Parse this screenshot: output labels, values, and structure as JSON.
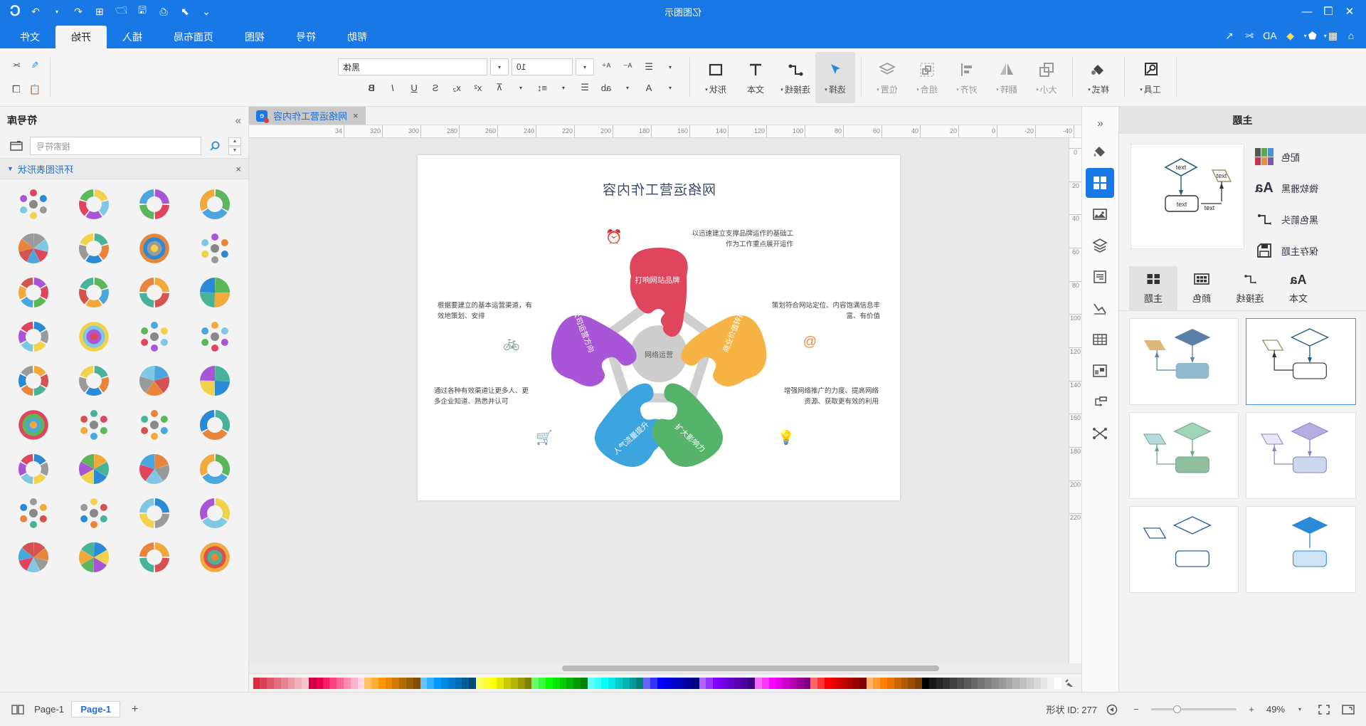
{
  "window": {
    "title": "亿图图示",
    "left_icons": [
      "close-icon",
      "restore-icon",
      "minimize-icon"
    ],
    "right_icons": [
      "chevron-down-icon",
      "export-icon",
      "print-icon",
      "save-icon",
      "open-icon",
      "new-icon",
      "undo-icon",
      "redo-icon"
    ],
    "logo": "C"
  },
  "quick_access": {
    "items": [
      "home-icon",
      "grid-icon",
      "shapes-icon",
      "ai-icon",
      "AD",
      "cut-icon",
      "pointer-icon"
    ]
  },
  "ribbon_tabs": [
    {
      "label": "文件",
      "active": false
    },
    {
      "label": "开始",
      "active": true
    },
    {
      "label": "插入",
      "active": false
    },
    {
      "label": "页面布局",
      "active": false
    },
    {
      "label": "视图",
      "active": false
    },
    {
      "label": "符号",
      "active": false
    },
    {
      "label": "帮助",
      "active": false
    }
  ],
  "ribbon": {
    "groups": [
      {
        "buttons": [
          {
            "label": "工具",
            "icon": "tool-icon",
            "dim": false,
            "caret": true,
            "selected": false
          },
          {
            "label": "样式",
            "icon": "fill-icon",
            "dim": false,
            "caret": true,
            "selected": false
          }
        ]
      },
      {
        "buttons": [
          {
            "label": "大小",
            "icon": "size-icon",
            "dim": true,
            "caret": true,
            "selected": false
          },
          {
            "label": "翻转",
            "icon": "flip-icon",
            "dim": true,
            "caret": true,
            "selected": false
          },
          {
            "label": "对齐",
            "icon": "align-icon",
            "dim": true,
            "caret": true,
            "selected": false
          },
          {
            "label": "组合",
            "icon": "group-icon",
            "dim": true,
            "caret": true,
            "selected": false
          },
          {
            "label": "位置",
            "icon": "layer-icon",
            "dim": true,
            "caret": true,
            "selected": false
          }
        ]
      },
      {
        "buttons": [
          {
            "label": "选择",
            "icon": "select-arrow-icon",
            "dim": false,
            "caret": true,
            "selected": true
          },
          {
            "label": "连接线",
            "icon": "connector-icon",
            "dim": false,
            "caret": true,
            "selected": false
          },
          {
            "label": "文本",
            "icon": "text-icon",
            "dim": false,
            "caret": false,
            "selected": false
          },
          {
            "label": "形状",
            "icon": "shape-icon",
            "dim": false,
            "caret": true,
            "selected": false
          }
        ]
      }
    ],
    "font": {
      "name_value": "黑体",
      "size_value": "10",
      "row1_icons": [
        "list-align-icon",
        "decrease-font-icon",
        "increase-font-icon"
      ],
      "row2_icons": [
        "font-color-icon",
        "highlight-icon",
        "bullets-icon",
        "line-spacing-icon",
        "clear-format-icon",
        "superscript-icon",
        "subscript-icon",
        "strikethrough-icon",
        "underline-icon",
        "italic-icon",
        "bold-icon"
      ],
      "clipboard_icons": [
        "copy-icon",
        "paste-icon",
        "format-painter-icon",
        "scissors-icon"
      ]
    }
  },
  "left_panel": {
    "title": "主题",
    "options": [
      {
        "label": "配色",
        "icon": "color-swatch-icon"
      },
      {
        "label": "微软雅黑",
        "icon": "font-Aa-icon"
      },
      {
        "label": "黑色箭头",
        "icon": "connector-icon"
      },
      {
        "label": "保存主题",
        "icon": "save-icon"
      }
    ],
    "tabs": [
      {
        "label": "文本",
        "icon": "font-Aa-icon",
        "active": false
      },
      {
        "label": "连接线",
        "icon": "connector-icon",
        "active": false
      },
      {
        "label": "颜色",
        "icon": "palette-grid-icon",
        "active": false
      },
      {
        "label": "主题",
        "icon": "theme-grid-icon",
        "active": true
      }
    ],
    "thumbnails": [
      {
        "id": "theme-1",
        "selected": false,
        "colors": [
          "#4a6fa5",
          "#ddb878",
          "#8fb8cc"
        ]
      },
      {
        "id": "theme-2",
        "selected": true,
        "colors": [
          "#ffffff",
          "#ffffff",
          "#ffffff"
        ]
      },
      {
        "id": "theme-3",
        "selected": false,
        "colors": [
          "#9fd4b4",
          "#b8d8e0",
          "#8fbf9e"
        ]
      },
      {
        "id": "theme-4",
        "selected": false,
        "colors": [
          "#b6aee0",
          "#ccd8ee",
          "#c9c0e8"
        ]
      },
      {
        "id": "theme-5",
        "selected": false,
        "colors": [
          "#2a8fd8",
          "#cfe3f2",
          "#2a8fd8"
        ]
      },
      {
        "id": "theme-6",
        "selected": false,
        "colors": [
          "#ffffff",
          "#ffffff",
          "#ffffff"
        ]
      }
    ]
  },
  "rail": {
    "top_icon": "collapse-left-icon",
    "buttons": [
      {
        "icon": "fill-bucket-icon",
        "active": false
      },
      {
        "icon": "shapes-grid-icon",
        "active": true
      },
      {
        "icon": "image-icon",
        "active": false
      },
      {
        "icon": "layers-icon",
        "active": false
      },
      {
        "icon": "notes-icon",
        "active": false
      },
      {
        "icon": "chart-icon",
        "active": false
      },
      {
        "icon": "table-icon",
        "active": false
      },
      {
        "icon": "container-icon",
        "active": false
      },
      {
        "icon": "flow-icon",
        "active": false
      },
      {
        "icon": "shuffle-icon",
        "active": false
      }
    ]
  },
  "document_tab": {
    "label": "网络运营工作内容",
    "close": "×"
  },
  "rulers": {
    "h_ticks": [
      "-40",
      "-20",
      "0",
      "20",
      "40",
      "60",
      "80",
      "100",
      "120",
      "140",
      "160",
      "180",
      "200",
      "220",
      "240",
      "260",
      "280",
      "300",
      "320",
      "34"
    ],
    "v_ticks": [
      "0",
      "20",
      "40",
      "60",
      "80",
      "100",
      "120",
      "140",
      "160",
      "180",
      "200",
      "220"
    ]
  },
  "right_panel": {
    "title": "符号库",
    "collapse_icon": "chevron-right-icon",
    "search_placeholder": "搜索符号",
    "library_icon": "library-icon",
    "search_icon": "search-icon",
    "category": "环形图表形状",
    "category_close": "×",
    "cells": [
      "donut-3-segment",
      "donut-5-segment",
      "donut-4-segment",
      "donut-gray-ring",
      "node-cluster-1",
      "hex-cluster",
      "donut-arrow-ring",
      "ring-outline",
      "dot-network-1",
      "dot-network-2",
      "block-network",
      "node-tree",
      "small-nodes-1",
      "small-nodes-2",
      "circle-nodes",
      "grid-network",
      "radial-blue",
      "target-rings",
      "pie-3-color",
      "flower-blue",
      "pie-4-color",
      "pie-multi",
      "pie-gray-orange",
      "pie-teal",
      "pie-rainbow",
      "pie-6-color",
      "pie-split",
      "donut-multi",
      "radial-chart-1",
      "radial-chart-2",
      "radial-chart-3",
      "radial-chart-4",
      "radial-chart-5",
      "radial-chart-6",
      "radial-chart-7",
      "radial-chart-8"
    ]
  },
  "status_bar": {
    "fit_icon": "fit-page-icon",
    "fullscreen_icon": "fullscreen-icon",
    "zoom_label": "49%",
    "zoom_minus": "−",
    "zoom_plus": "+",
    "play_icon": "present-icon",
    "object_id_label": "形状 ID: 277",
    "add_page": "+",
    "page_tab": "Page-1",
    "page_name": "Page-1",
    "view_icon": "view-mode-icon"
  },
  "diagram": {
    "title": "网络运营工作内容",
    "center_label": "网络运营",
    "pieces": [
      {
        "name": "打响网站品牌",
        "color": "#e0455e",
        "position": "top"
      },
      {
        "name": "公司运营方向",
        "color": "#a855d8",
        "position": "right"
      },
      {
        "name": "人气流量提升",
        "color": "#3ca5e0",
        "position": "bottom-right"
      },
      {
        "name": "扩大影响力",
        "color": "#55b46a",
        "position": "bottom-left"
      },
      {
        "name": "商业价值转换",
        "color": "#f7b343",
        "position": "left"
      }
    ],
    "notes": [
      {
        "text": "以迅速建立支撑品牌运作的基础工\n作为工作重点展开运作",
        "icon": "alarm-clock-icon",
        "icon_color": "#e8453c",
        "position": "top"
      },
      {
        "text": "根据要建立的基本运营渠道，有\n效地策划、安排",
        "icon": "bicycle-icon",
        "icon_color": "#a855d8",
        "position": "right"
      },
      {
        "text": "通过各种有效渠道让更多人、更\n多企业知道、熟悉并认可",
        "icon": "cart-icon",
        "icon_color": "#3ca5e0",
        "position": "bottom-right"
      },
      {
        "text": "增强网络推广的力度、提高网络\n资源、获取更有效的利用",
        "icon": "bulb-icon",
        "icon_color": "#8ec63f",
        "position": "bottom-left"
      },
      {
        "text": "策划符合网站定位、内容饱满信息丰\n富、有价值",
        "icon": "at-icon",
        "icon_color": "#f08a3c",
        "position": "left"
      }
    ]
  },
  "palette_colors": [
    "#ffffff",
    "#f2f2f2",
    "#e6e6e6",
    "#d9d9d9",
    "#cccccc",
    "#bfbfbf",
    "#b3b3b3",
    "#a6a6a6",
    "#999999",
    "#8c8c8c",
    "#808080",
    "#737373",
    "#666666",
    "#595959",
    "#4d4d4d",
    "#404040",
    "#333333",
    "#262626",
    "#1a1a1a",
    "#000000",
    "#7f3f00",
    "#994c00",
    "#b35900",
    "#cc6600",
    "#e67300",
    "#ff8000",
    "#ff9933",
    "#ffb366",
    "#7f0000",
    "#990000",
    "#b30000",
    "#cc0000",
    "#e60000",
    "#ff0000",
    "#ff3333",
    "#ff6666",
    "#7f007f",
    "#990099",
    "#b300b3",
    "#cc00cc",
    "#e600e6",
    "#ff00ff",
    "#ff33ff",
    "#ff66ff",
    "#3f007f",
    "#4c0099",
    "#5900b3",
    "#6600cc",
    "#7300e6",
    "#8000ff",
    "#9933ff",
    "#b366ff",
    "#00007f",
    "#000099",
    "#0000b3",
    "#0000cc",
    "#0000e6",
    "#0000ff",
    "#3333ff",
    "#6666ff",
    "#007f7f",
    "#009999",
    "#00b3b3",
    "#00cccc",
    "#00e6e6",
    "#00ffff",
    "#33ffff",
    "#66ffff",
    "#007f00",
    "#009900",
    "#00b300",
    "#00cc00",
    "#00e600",
    "#00ff00",
    "#33ff33",
    "#66ff66",
    "#7f7f00",
    "#999900",
    "#b3b300",
    "#cccc00",
    "#e6e600",
    "#ffff00",
    "#ffff33",
    "#ffff66",
    "#004c7f",
    "#005c99",
    "#006bb3",
    "#007acc",
    "#008ae6",
    "#0099ff",
    "#33adff",
    "#66c2ff",
    "#7f4c00",
    "#995c00",
    "#b36b00",
    "#cc7a00",
    "#e68a00",
    "#ff9900",
    "#ffad33",
    "#ffc266",
    "#ffd9e6",
    "#ffb3cc",
    "#ff8cb3",
    "#ff6699",
    "#ff4080",
    "#ff1a66",
    "#e6004c",
    "#cc0044",
    "#f5c6cb",
    "#f1b0b7",
    "#ec9aa3",
    "#e8848f",
    "#e36e7b",
    "#df5867",
    "#da4253",
    "#d62c3f"
  ]
}
